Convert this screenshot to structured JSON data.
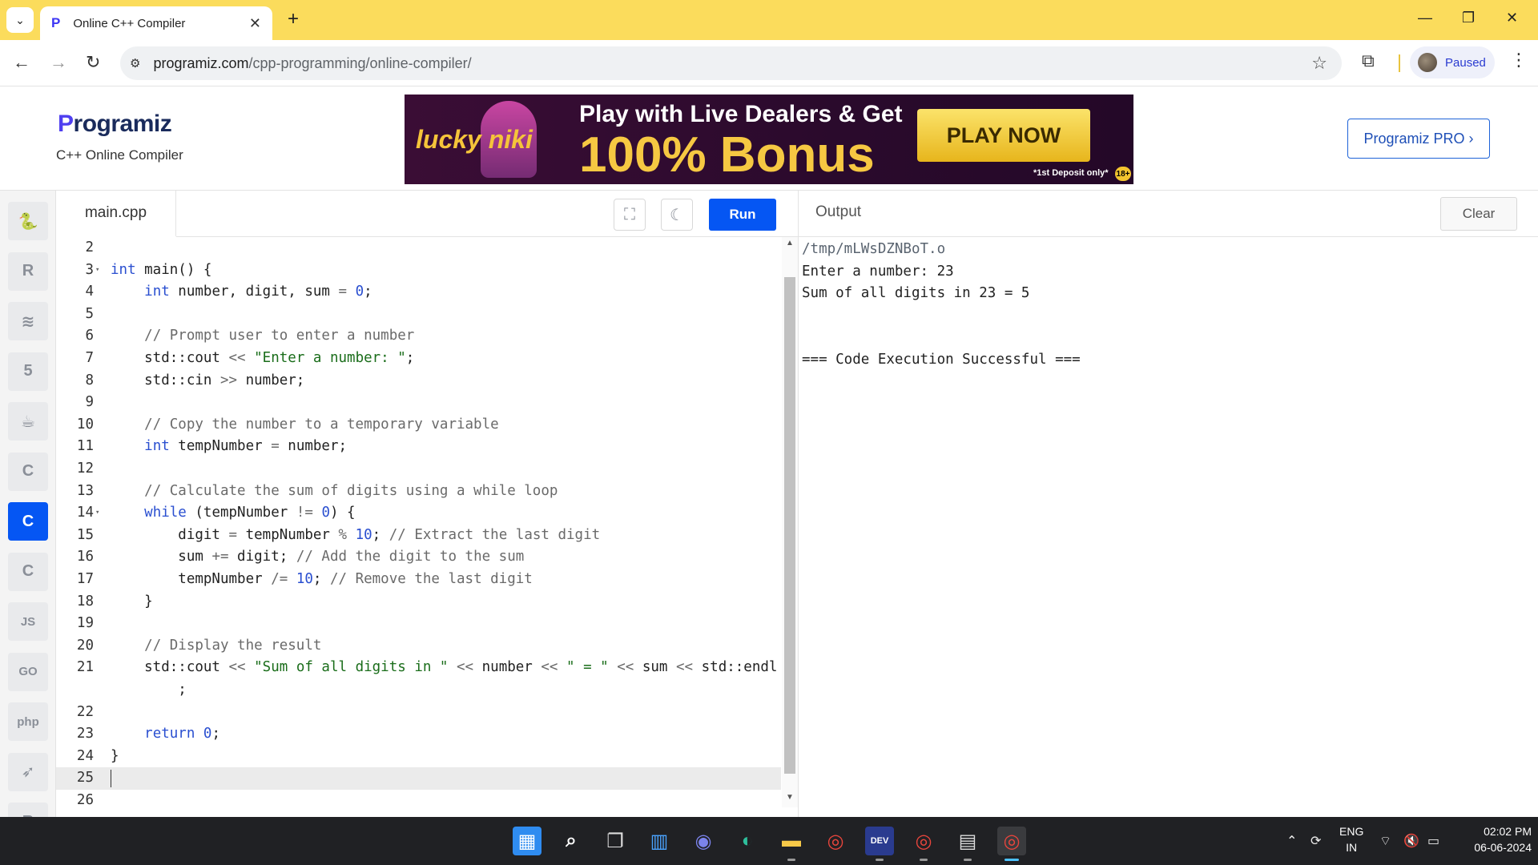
{
  "browser": {
    "tab_title": "Online C++ Compiler",
    "url_host": "programiz.com",
    "url_path": "/cpp-programming/online-compiler/",
    "profile_label": "Paused"
  },
  "header": {
    "logo_first": "P",
    "logo_rest": "rogramiz",
    "subtitle": "C++ Online Compiler",
    "pro_button": "Programiz PRO ›"
  },
  "ad": {
    "brand": "lucky niki",
    "line1": "Play with Live Dealers & Get",
    "line2": "100% Bonus",
    "cta": "PLAY NOW",
    "fine_print": "*1st Deposit only*",
    "age": "18+"
  },
  "sidebar": {
    "items": [
      {
        "name": "python",
        "glyph": "🐍"
      },
      {
        "name": "r",
        "glyph": "R"
      },
      {
        "name": "sql",
        "glyph": "≋"
      },
      {
        "name": "html",
        "glyph": "5"
      },
      {
        "name": "java",
        "glyph": "☕"
      },
      {
        "name": "c",
        "glyph": "C"
      },
      {
        "name": "cpp",
        "glyph": "C"
      },
      {
        "name": "csharp",
        "glyph": "C"
      },
      {
        "name": "js",
        "glyph": "JS"
      },
      {
        "name": "go",
        "glyph": "GO"
      },
      {
        "name": "php",
        "glyph": "php"
      },
      {
        "name": "swift",
        "glyph": "➶"
      },
      {
        "name": "rust",
        "glyph": "R"
      }
    ],
    "active": "cpp"
  },
  "editor": {
    "filename": "main.cpp",
    "run_label": "Run",
    "lines": [
      {
        "n": "2",
        "t": ""
      },
      {
        "n": "3",
        "t": "int main() {",
        "fold": true
      },
      {
        "n": "4",
        "t": "    int number, digit, sum = 0;"
      },
      {
        "n": "5",
        "t": ""
      },
      {
        "n": "6",
        "t": "    // Prompt user to enter a number"
      },
      {
        "n": "7",
        "t": "    std::cout << \"Enter a number: \";"
      },
      {
        "n": "8",
        "t": "    std::cin >> number;"
      },
      {
        "n": "9",
        "t": ""
      },
      {
        "n": "10",
        "t": "    // Copy the number to a temporary variable"
      },
      {
        "n": "11",
        "t": "    int tempNumber = number;"
      },
      {
        "n": "12",
        "t": ""
      },
      {
        "n": "13",
        "t": "    // Calculate the sum of digits using a while loop"
      },
      {
        "n": "14",
        "t": "    while (tempNumber != 0) {",
        "fold": true
      },
      {
        "n": "15",
        "t": "        digit = tempNumber % 10; // Extract the last digit"
      },
      {
        "n": "16",
        "t": "        sum += digit; // Add the digit to the sum"
      },
      {
        "n": "17",
        "t": "        tempNumber /= 10; // Remove the last digit"
      },
      {
        "n": "18",
        "t": "    }"
      },
      {
        "n": "19",
        "t": ""
      },
      {
        "n": "20",
        "t": "    // Display the result"
      },
      {
        "n": "21",
        "t": "    std::cout << \"Sum of all digits in \" << number << \" = \" << sum << std::endl"
      },
      {
        "n": "",
        "t": "        ;"
      },
      {
        "n": "22",
        "t": ""
      },
      {
        "n": "23",
        "t": "    return 0;"
      },
      {
        "n": "24",
        "t": "}"
      },
      {
        "n": "25",
        "t": "",
        "current": true
      },
      {
        "n": "26",
        "t": ""
      }
    ]
  },
  "output": {
    "title": "Output",
    "clear_label": "Clear",
    "lines": [
      "/tmp/mLWsDZNBoT.o",
      "Enter a number: 23",
      "Sum of all digits in 23 = 5",
      "",
      "",
      "=== Code Execution Successful ==="
    ]
  },
  "taskbar": {
    "language_line1": "ENG",
    "language_line2": "IN",
    "time": "02:02 PM",
    "date": "06-06-2024",
    "apps": [
      "start",
      "search",
      "task-view",
      "widgets",
      "teams",
      "edge",
      "file-explorer",
      "chrome",
      "devcpp",
      "chrome-profile",
      "notepad",
      "chrome-active"
    ]
  }
}
